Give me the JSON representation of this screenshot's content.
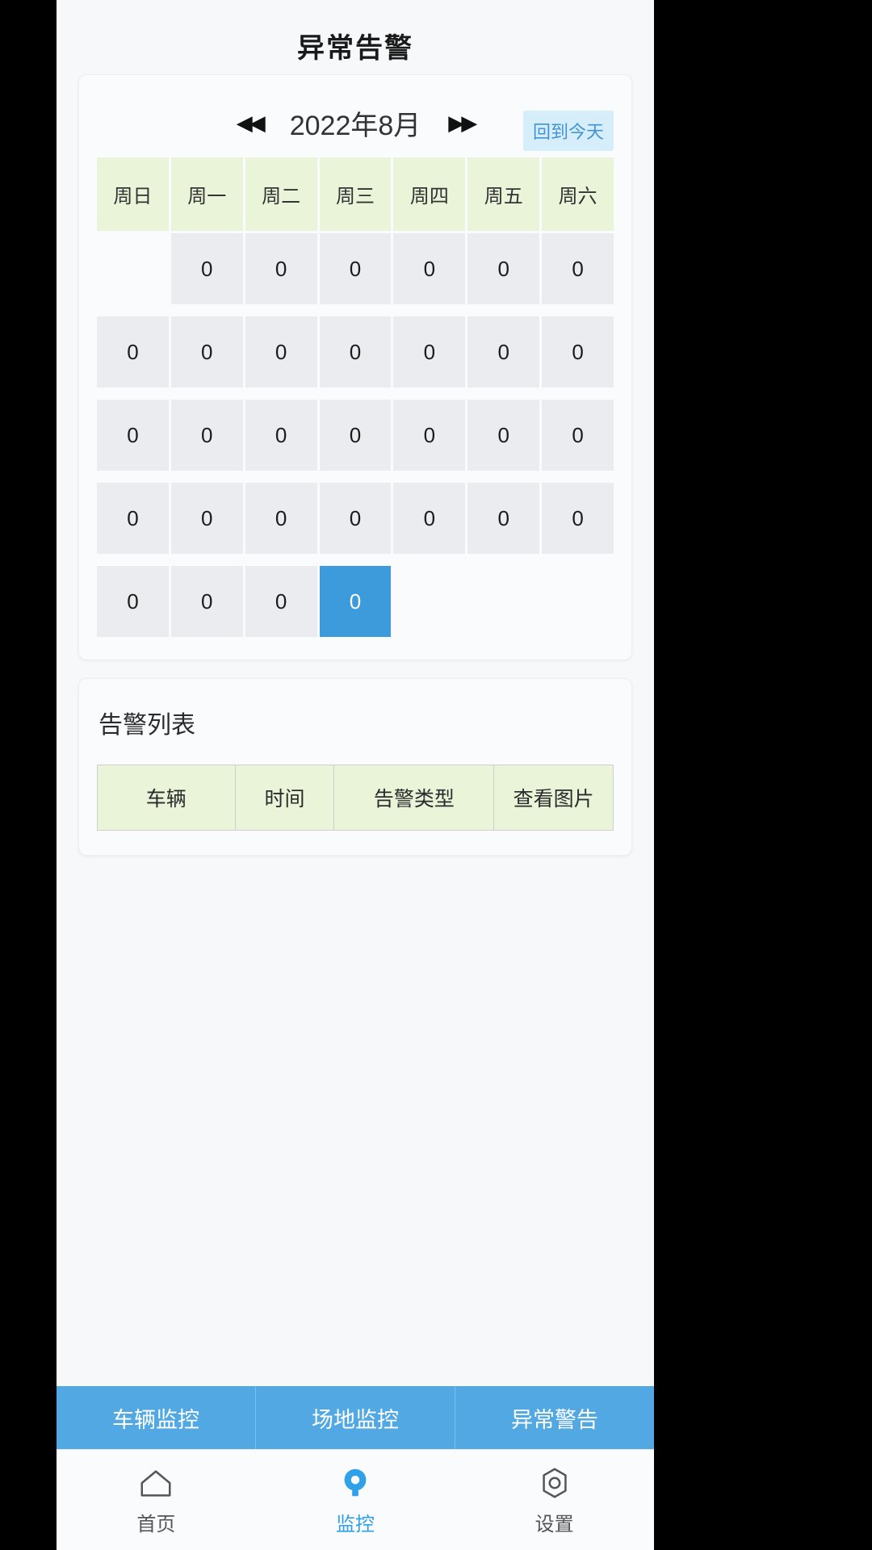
{
  "header": {
    "title": "异常告警"
  },
  "calendar": {
    "prev_label": "◀◀",
    "next_label": "▶▶",
    "month_label": "2022年8月",
    "today_button": "回到今天",
    "weekdays": [
      "周日",
      "周一",
      "周二",
      "周三",
      "周四",
      "周五",
      "周六"
    ],
    "rows": [
      [
        {
          "value": "",
          "empty": true
        },
        {
          "value": "0"
        },
        {
          "value": "0"
        },
        {
          "value": "0"
        },
        {
          "value": "0"
        },
        {
          "value": "0"
        },
        {
          "value": "0"
        }
      ],
      [
        {
          "value": "0"
        },
        {
          "value": "0"
        },
        {
          "value": "0"
        },
        {
          "value": "0"
        },
        {
          "value": "0"
        },
        {
          "value": "0"
        },
        {
          "value": "0"
        }
      ],
      [
        {
          "value": "0"
        },
        {
          "value": "0"
        },
        {
          "value": "0"
        },
        {
          "value": "0"
        },
        {
          "value": "0"
        },
        {
          "value": "0"
        },
        {
          "value": "0"
        }
      ],
      [
        {
          "value": "0"
        },
        {
          "value": "0"
        },
        {
          "value": "0"
        },
        {
          "value": "0"
        },
        {
          "value": "0"
        },
        {
          "value": "0"
        },
        {
          "value": "0"
        }
      ],
      [
        {
          "value": "0"
        },
        {
          "value": "0"
        },
        {
          "value": "0"
        },
        {
          "value": "0",
          "selected": true
        },
        {
          "value": "",
          "empty": true
        },
        {
          "value": "",
          "empty": true
        },
        {
          "value": "",
          "empty": true
        }
      ]
    ]
  },
  "alarm_list": {
    "title": "告警列表",
    "columns": [
      "车辆",
      "时间",
      "告警类型",
      "查看图片"
    ],
    "rows": []
  },
  "segment_tabs": [
    {
      "label": "车辆监控",
      "active": false
    },
    {
      "label": "场地监控",
      "active": false
    },
    {
      "label": "异常警告",
      "active": true
    }
  ],
  "bottom_nav": [
    {
      "label": "首页",
      "icon": "home-icon",
      "active": false
    },
    {
      "label": "监控",
      "icon": "monitor-camera-icon",
      "active": true
    },
    {
      "label": "设置",
      "icon": "gear-icon",
      "active": false
    }
  ],
  "colors": {
    "accent_blue": "#3d9bdc",
    "tab_blue": "#52a8e2",
    "today_chip_bg": "#d6edfa",
    "today_chip_text": "#4294d6",
    "header_green": "#e9f4d9",
    "cell_gray": "#eaecf0",
    "page_bg": "#f7f8f9"
  }
}
